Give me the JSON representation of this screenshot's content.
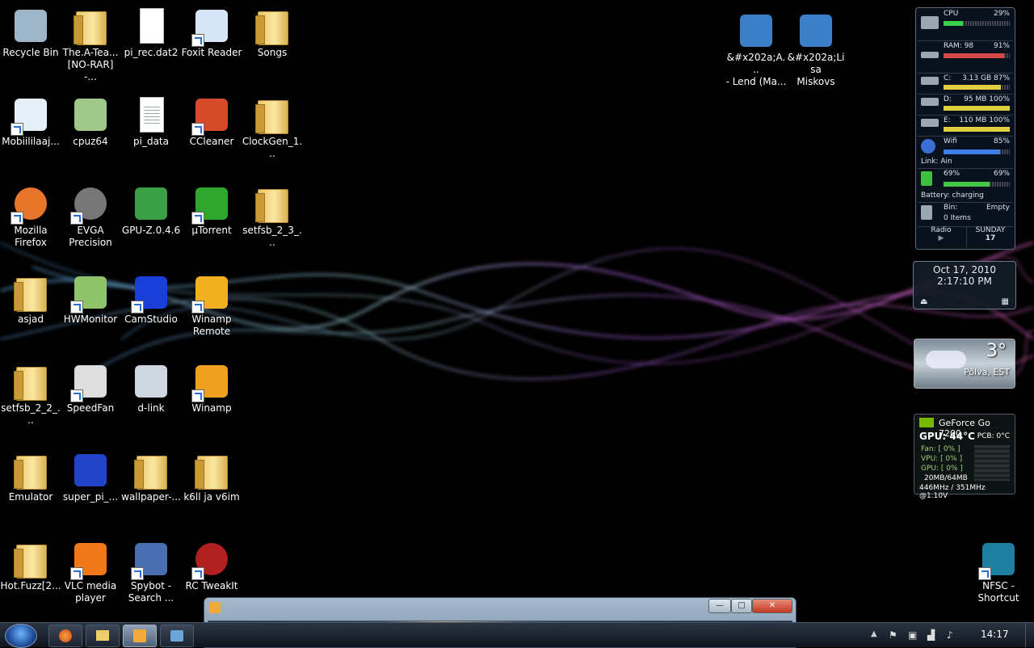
{
  "desktop_icons": [
    {
      "label": "Recycle Bin",
      "icon": "recycle-bin-icon"
    },
    {
      "label": "The.A-Tea...\n[NO-RAR] -...",
      "icon": "folder-icon"
    },
    {
      "label": "pi_rec.dat2",
      "icon": "file-icon"
    },
    {
      "label": "Foxit Reader",
      "icon": "foxit-reader-icon"
    },
    {
      "label": "Songs",
      "icon": "folder-icon"
    },
    {
      "label": "Mobiililaaj...",
      "icon": "modem-icon"
    },
    {
      "label": "cpuz64",
      "icon": "cpuz-icon"
    },
    {
      "label": "pi_data",
      "icon": "text-file-icon"
    },
    {
      "label": "CCleaner",
      "icon": "ccleaner-icon"
    },
    {
      "label": "ClockGen_1...",
      "icon": "folder-icon"
    },
    {
      "label": "Mozilla\nFirefox",
      "icon": "firefox-icon"
    },
    {
      "label": "EVGA\nPrecision",
      "icon": "evga-precision-icon"
    },
    {
      "label": "GPU-Z.0.4.6",
      "icon": "gpu-z-icon"
    },
    {
      "label": "µTorrent",
      "icon": "utorrent-icon"
    },
    {
      "label": "setfsb_2_3_...",
      "icon": "folder-icon"
    },
    {
      "label": "asjad",
      "icon": "folder-icon"
    },
    {
      "label": "HWMonitor",
      "icon": "hwmonitor-icon"
    },
    {
      "label": "CamStudio",
      "icon": "camstudio-icon"
    },
    {
      "label": "Winamp\nRemote",
      "icon": "winamp-remote-icon"
    },
    {
      "label": "setfsb_2_2_...",
      "icon": "folder-icon"
    },
    {
      "label": "SpeedFan",
      "icon": "speedfan-icon"
    },
    {
      "label": "d-link",
      "icon": "video-file-icon"
    },
    {
      "label": "Winamp",
      "icon": "winamp-icon"
    },
    {
      "label": "Emulator",
      "icon": "folder-icon"
    },
    {
      "label": "super_pi_...",
      "icon": "super-pi-icon"
    },
    {
      "label": "wallpaper-...",
      "icon": "folder-icon"
    },
    {
      "label": "k6ll ja v6im",
      "icon": "folder-icon"
    },
    {
      "label": "Hot.Fuzz[2...",
      "icon": "folder-icon"
    },
    {
      "label": "VLC media\nplayer",
      "icon": "vlc-icon"
    },
    {
      "label": "Spybot -\nSearch ...",
      "icon": "spybot-icon"
    },
    {
      "label": "RC TweakIt",
      "icon": "rc-tweakit-icon"
    },
    {
      "label": "&#x202a;A...\n- Lend (Ma...",
      "icon": "video-thumbnail-icon"
    },
    {
      "label": "&#x202a;Lisa\nMiskovs",
      "icon": "video-thumbnail-icon"
    },
    {
      "label": "NFSC -\nShortcut",
      "icon": "nfsc-icon"
    }
  ],
  "system_gadget": {
    "cpu": {
      "label": "CPU",
      "value": "29%",
      "fraction": 0.29
    },
    "ram": {
      "label": "RAM: 98",
      "value": "91%",
      "fraction": 0.91
    },
    "drive_c": {
      "label": "C:",
      "value": "3.13 GB 87%",
      "fraction": 0.87
    },
    "drive_d": {
      "label": "D:",
      "value": "95 MB 100%",
      "fraction": 1.0
    },
    "drive_e": {
      "label": "E:",
      "value": "110 MB 100%",
      "fraction": 1.0
    },
    "wifi": {
      "label": "Wifi",
      "value": "85%",
      "link": "Link: Ain",
      "fraction": 0.85
    },
    "battery": {
      "label": "69%",
      "value": "69%",
      "status": "Battery: charging",
      "fraction": 0.69
    },
    "bin": {
      "label": "Bin:",
      "value": "Empty",
      "items": "0 Items"
    },
    "radio": {
      "label": "Radio"
    },
    "day": {
      "name": "SUNDAY",
      "num": "17"
    }
  },
  "clock_gadget": {
    "date": "Oct 17, 2010",
    "time": "2:17:10 PM"
  },
  "weather_gadget": {
    "temp": "3°",
    "location": "Põlva, EST"
  },
  "gpu_gadget": {
    "title": "GeForce Go 7200",
    "gpu_temp": "GPU: 44°C",
    "pcb": "PCB: 0°C",
    "fan": "Fan: [ 0% ]",
    "vpu": "VPU: [ 0% ]",
    "gpu_load": "GPU: [ 0% ]",
    "mem": "20MB/64MB",
    "clocks": "446MHz / 351MHz @1.10V"
  },
  "window": {
    "buttons": [
      "minimize",
      "maximize",
      "close"
    ]
  },
  "taskbar": {
    "buttons": [
      "firefox",
      "explorer",
      "media-player",
      "network"
    ],
    "time": "14:17"
  }
}
